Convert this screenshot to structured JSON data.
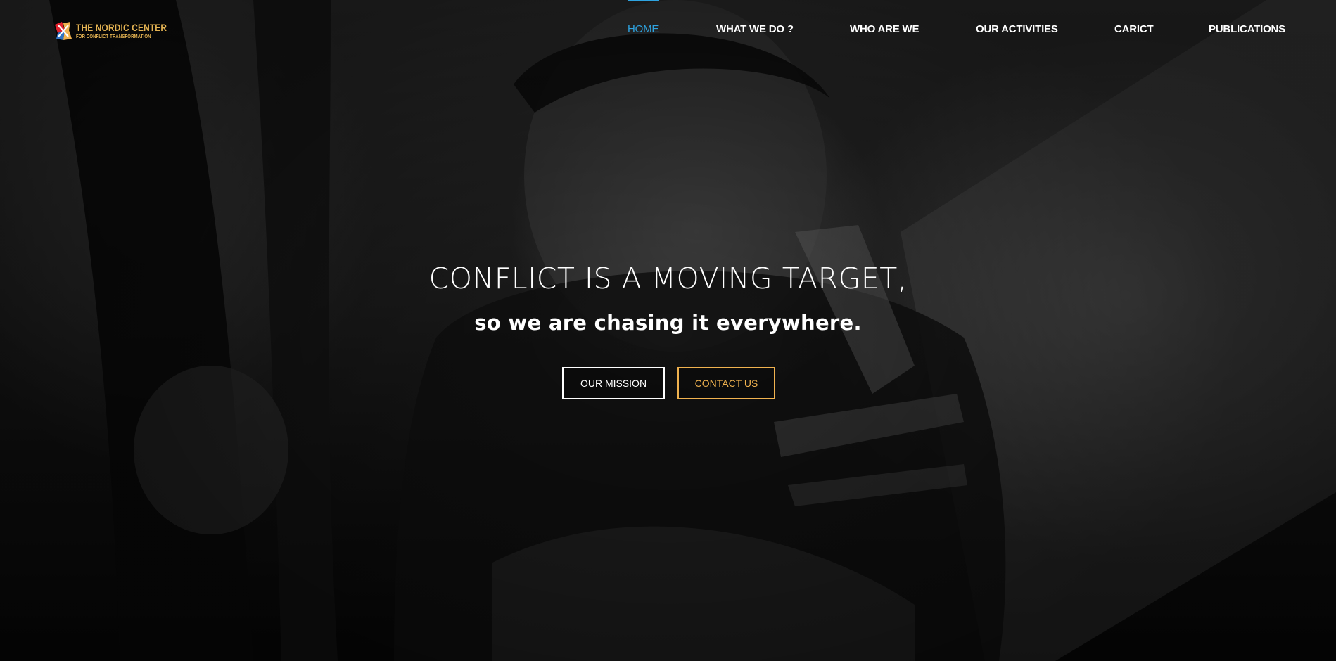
{
  "brand": {
    "name_line1": "THE NORDIC CENTER",
    "name_line2": "FOR CONFLICT TRANSFORMATION",
    "icon": "nordic-center-logo-mark",
    "color": "#e4b352"
  },
  "nav": {
    "items": [
      {
        "label": "HOME",
        "active": true
      },
      {
        "label": "WHAT WE DO ?",
        "active": false
      },
      {
        "label": "WHO ARE WE",
        "active": false
      },
      {
        "label": "OUR ACTIVITIES",
        "active": false
      },
      {
        "label": "CARICT",
        "active": false
      },
      {
        "label": "PUBLICATIONS",
        "active": false
      }
    ],
    "active_color": "#2ea3e0"
  },
  "hero": {
    "headline": "CONFLICT IS A MOVING TARGET,",
    "subheadline": "so we are chasing it everywhere.",
    "buttons": {
      "mission": "OUR MISSION",
      "contact": "CONTACT US"
    },
    "contact_color": "#f0b24f"
  }
}
